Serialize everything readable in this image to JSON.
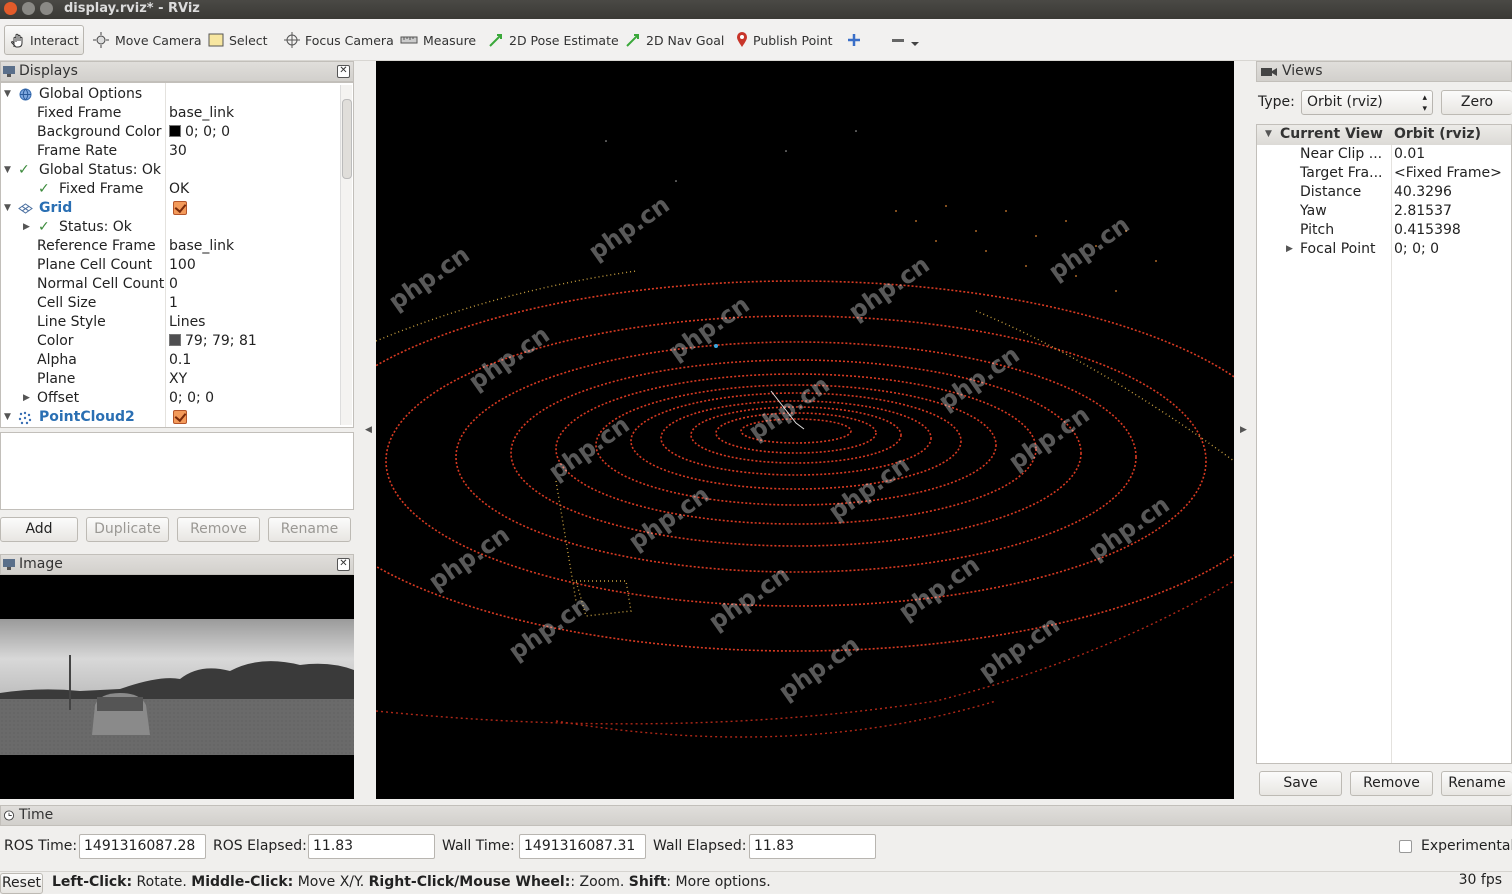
{
  "window": {
    "title": "display.rviz* - RViz"
  },
  "toolbar": {
    "interact": "Interact",
    "move_camera": "Move Camera",
    "select": "Select",
    "focus_camera": "Focus Camera",
    "measure": "Measure",
    "pose_estimate": "2D Pose Estimate",
    "nav_goal": "2D Nav Goal",
    "publish_point": "Publish Point"
  },
  "displays": {
    "title": "Displays",
    "rows": [
      {
        "name": "Global Options",
        "value": ""
      },
      {
        "name": "Fixed Frame",
        "value": "base_link"
      },
      {
        "name": "Background Color",
        "value": "0; 0; 0",
        "color": "#000000"
      },
      {
        "name": "Frame Rate",
        "value": "30"
      },
      {
        "name": "Global Status: Ok",
        "value": ""
      },
      {
        "name": "Fixed Frame",
        "value": "OK"
      },
      {
        "name": "Grid",
        "value": ""
      },
      {
        "name": "Status: Ok",
        "value": ""
      },
      {
        "name": "Reference Frame",
        "value": "base_link"
      },
      {
        "name": "Plane Cell Count",
        "value": "100"
      },
      {
        "name": "Normal Cell Count",
        "value": "0"
      },
      {
        "name": "Cell Size",
        "value": "1"
      },
      {
        "name": "Line Style",
        "value": "Lines"
      },
      {
        "name": "Color",
        "value": "79; 79; 81",
        "color": "#4f4f51"
      },
      {
        "name": "Alpha",
        "value": "0.1"
      },
      {
        "name": "Plane",
        "value": "XY"
      },
      {
        "name": "Offset",
        "value": "0; 0; 0"
      },
      {
        "name": "PointCloud2",
        "value": ""
      }
    ],
    "buttons": {
      "add": "Add",
      "duplicate": "Duplicate",
      "remove": "Remove",
      "rename": "Rename"
    }
  },
  "image_panel": {
    "title": "Image"
  },
  "views": {
    "title": "Views",
    "type_label": "Type:",
    "type_value": "Orbit (rviz)",
    "zero": "Zero",
    "header_name": "Current View",
    "header_value": "Orbit (rviz)",
    "rows": [
      {
        "name": "Near Clip ...",
        "value": "0.01"
      },
      {
        "name": "Target Fra...",
        "value": "<Fixed Frame>"
      },
      {
        "name": "Distance",
        "value": "40.3296"
      },
      {
        "name": "Yaw",
        "value": "2.81537"
      },
      {
        "name": "Pitch",
        "value": "0.415398"
      },
      {
        "name": "Focal Point",
        "value": "0; 0; 0"
      }
    ],
    "buttons": {
      "save": "Save",
      "remove": "Remove",
      "rename": "Rename"
    }
  },
  "time": {
    "title": "Time",
    "ros_time_label": "ROS Time:",
    "ros_time": "1491316087.28",
    "ros_elapsed_label": "ROS Elapsed:",
    "ros_elapsed": "11.83",
    "wall_time_label": "Wall Time:",
    "wall_time": "1491316087.31",
    "wall_elapsed_label": "Wall Elapsed:",
    "wall_elapsed": "11.83",
    "experimental": "Experimental"
  },
  "status": {
    "reset": "Reset",
    "h1": "Left-Click:",
    "t1": " Rotate. ",
    "h2": "Middle-Click:",
    "t2": " Move X/Y. ",
    "h3": "Right-Click/Mouse Wheel:",
    "t3": ": Zoom. ",
    "h4": "Shift",
    "t4": ": More options.",
    "fps": "30 fps"
  },
  "watermark": "php.cn"
}
